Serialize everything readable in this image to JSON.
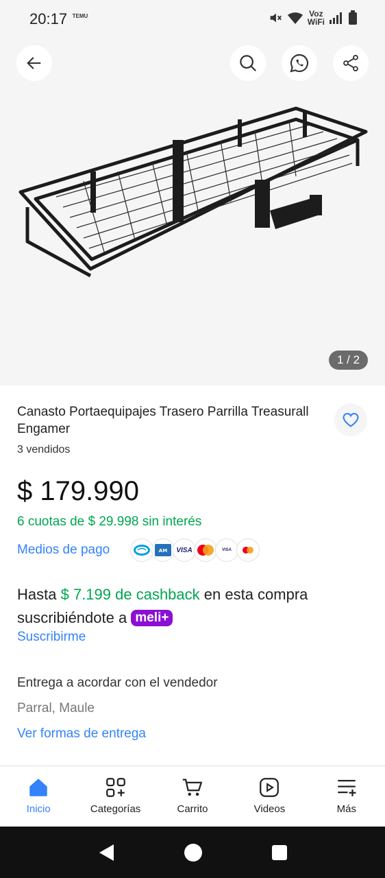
{
  "status_bar": {
    "time": "20:17",
    "temu_label": "TEMU",
    "voz": "Voz",
    "wifi": "WiFi"
  },
  "gallery": {
    "counter": "1 / 2"
  },
  "product": {
    "title": "Canasto Portaequipajes Trasero Parrilla Treasurall Engamer",
    "sold": "3 vendidos",
    "price": "$ 179.990",
    "installments": "6 cuotas de $ 29.998 sin interés",
    "payment_methods_label": "Medios de pago",
    "payment_icons": [
      "mercadopago-icon",
      "amex-icon",
      "visa-icon",
      "mastercard-icon",
      "visa-debit-icon",
      "mastercard-debit-icon"
    ]
  },
  "cashback": {
    "prefix": "Hasta",
    "amount": "$ 7.199 de cashback",
    "middle": "en esta compra suscribiéndote a",
    "badge": "meli+",
    "subscribe_label": "Suscribirme"
  },
  "delivery": {
    "text": "Entrega a acordar con el vendedor",
    "location": "Parral, Maule",
    "link": "Ver formas de entrega"
  },
  "tabbar": {
    "items": [
      {
        "label": "Inicio",
        "icon": "home-icon",
        "active": true
      },
      {
        "label": "Categorías",
        "icon": "categories-icon",
        "active": false
      },
      {
        "label": "Carrito",
        "icon": "cart-icon",
        "active": false
      },
      {
        "label": "Videos",
        "icon": "videos-icon",
        "active": false
      },
      {
        "label": "Más",
        "icon": "more-icon",
        "active": false
      }
    ]
  },
  "colors": {
    "accent": "#3483fa",
    "green": "#00a650",
    "meli_plus": "#8a10d3"
  }
}
